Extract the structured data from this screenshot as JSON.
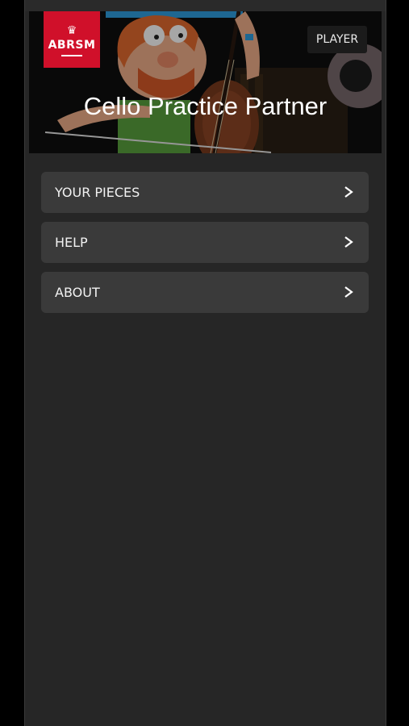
{
  "header": {
    "logo_text": "ABRSM",
    "player_label": "PLAYER",
    "title": "Cello Practice Partner"
  },
  "menu": {
    "items": [
      {
        "label": "YOUR PIECES"
      },
      {
        "label": "HELP"
      },
      {
        "label": "ABOUT"
      }
    ]
  },
  "colors": {
    "brand_red": "#d0102a",
    "background": "#262626",
    "menu_item_bg": "#3a3a3a"
  },
  "icons": [
    "crown-icon",
    "chevron-right-icon"
  ]
}
